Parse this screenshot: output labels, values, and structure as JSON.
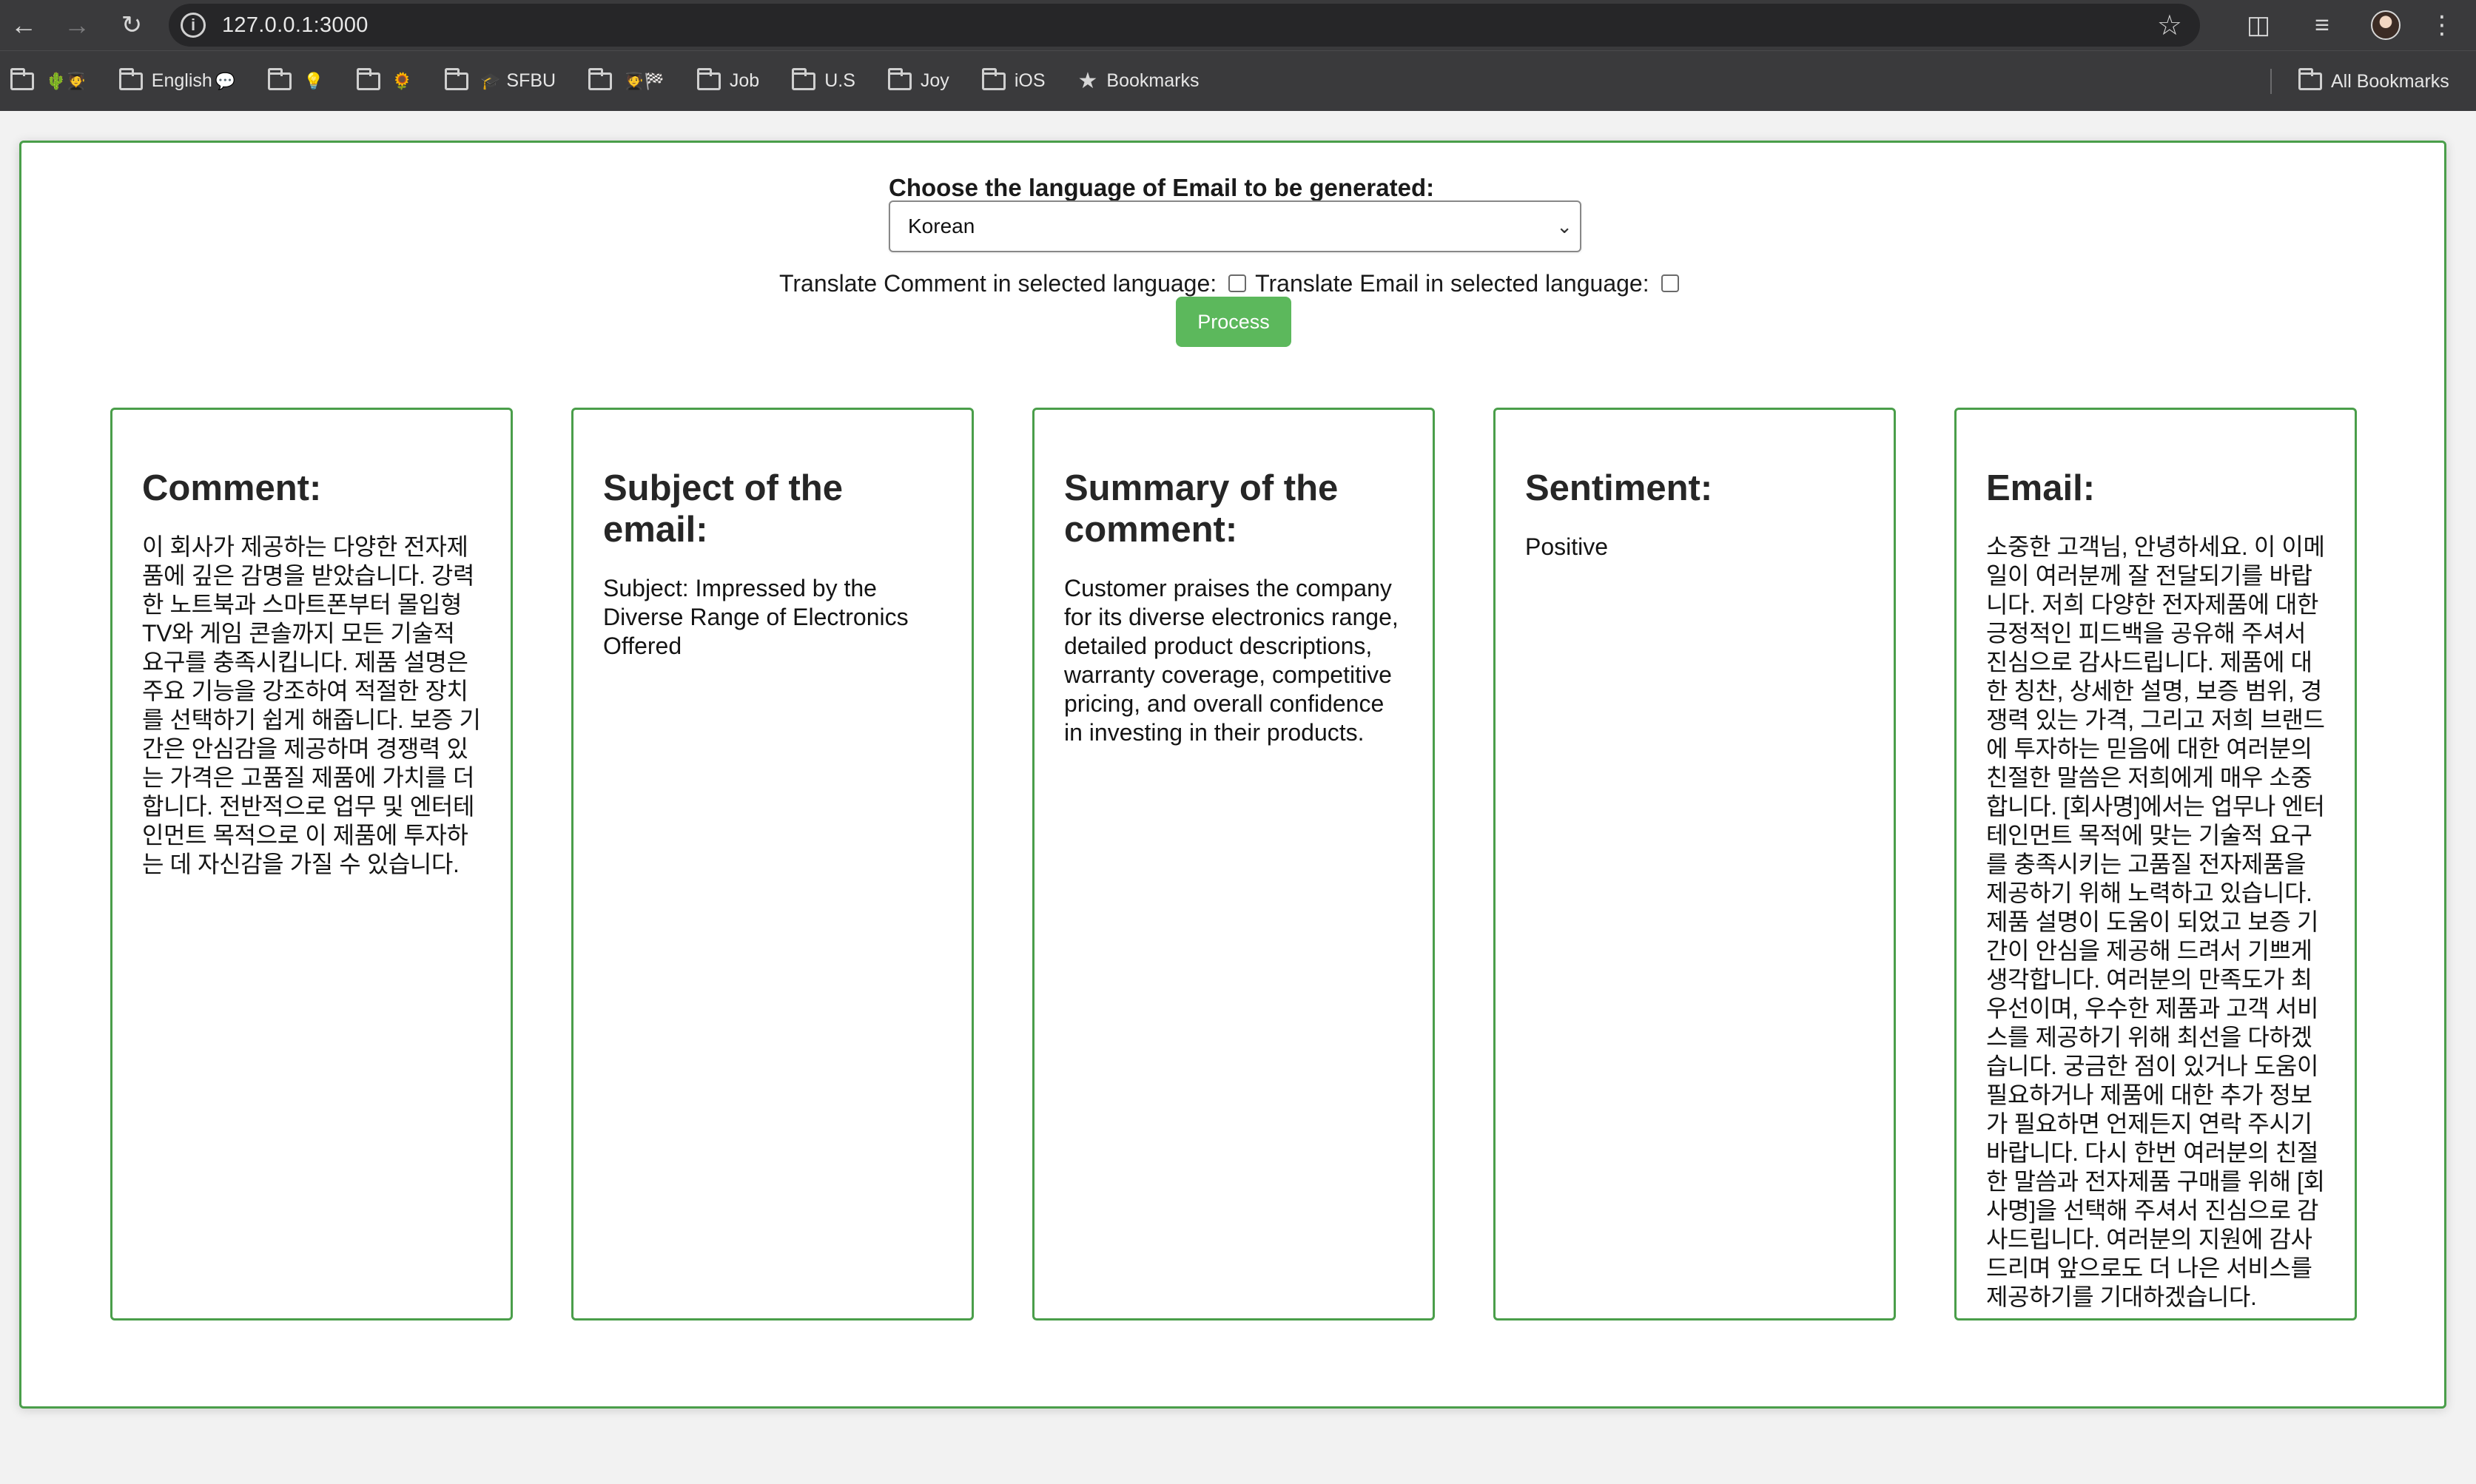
{
  "browser": {
    "url": "127.0.0.1:3000",
    "bookmarks": [
      {
        "label": "",
        "emoji": "🌵🧑‍🎓"
      },
      {
        "label": "English",
        "emoji": "💬"
      },
      {
        "label": "",
        "emoji": "💡"
      },
      {
        "label": "",
        "emoji": "🌻"
      },
      {
        "label": "SFBU",
        "emoji": "🎓"
      },
      {
        "label": "",
        "emoji": "🧑‍🎓🏁"
      },
      {
        "label": "Job",
        "emoji": ""
      },
      {
        "label": "U.S",
        "emoji": ""
      },
      {
        "label": "Joy",
        "emoji": ""
      },
      {
        "label": "iOS",
        "emoji": ""
      }
    ],
    "bookmarks_star_label": "Bookmarks",
    "all_bookmarks_label": "All Bookmarks"
  },
  "form": {
    "language_label": "Choose the language of Email to be generated:",
    "selected_language": "Korean",
    "translate_comment_label": "Translate Comment in selected language:",
    "translate_email_label": "Translate Email in selected language:",
    "process_label": "Process"
  },
  "cards": {
    "comment": {
      "title": "Comment:",
      "body": "이 회사가 제공하는 다양한 전자제품에 깊은 감명을 받았습니다. 강력한 노트북과 스마트폰부터 몰입형 TV와 게임 콘솔까지 모든 기술적 요구를 충족시킵니다. 제품 설명은 주요 기능을 강조하여 적절한 장치를 선택하기 쉽게 해줍니다. 보증 기간은 안심감을 제공하며 경쟁력 있는 가격은 고품질 제품에 가치를 더합니다. 전반적으로 업무 및 엔터테인먼트 목적으로 이 제품에 투자하는 데 자신감을 가질 수 있습니다."
    },
    "subject": {
      "title": "Subject of the email:",
      "body": "Subject: Impressed by the Diverse Range of Electronics Offered"
    },
    "summary": {
      "title": "Summary of the comment:",
      "body": "Customer praises the company for its diverse electronics range, detailed product descriptions, warranty coverage, competitive pricing, and overall confidence in investing in their products."
    },
    "sentiment": {
      "title": "Sentiment:",
      "body": "Positive"
    },
    "email": {
      "title": "Email:",
      "body": "소중한 고객님, 안녕하세요. 이 이메일이 여러분께 잘 전달되기를 바랍니다. 저희 다양한 전자제품에 대한 긍정적인 피드백을 공유해 주셔서 진심으로 감사드립니다. 제품에 대한 칭찬, 상세한 설명, 보증 범위, 경쟁력 있는 가격, 그리고 저희 브랜드에 투자하는 믿음에 대한 여러분의 친절한 말씀은 저희에게 매우 소중합니다. [회사명]에서는 업무나 엔터테인먼트 목적에 맞는 기술적 요구를 충족시키는 고품질 전자제품을 제공하기 위해 노력하고 있습니다. 제품 설명이 도움이 되었고 보증 기간이 안심을 제공해 드려서 기쁘게 생각합니다. 여러분의 만족도가 최우선이며, 우수한 제품과 고객 서비스를 제공하기 위해 최선을 다하겠습니다. 궁금한 점이 있거나 도움이 필요하거나 제품에 대한 추가 정보가 필요하면 언제든지 연락 주시기 바랍니다. 다시 한번 여러분의 친절한 말씀과 전자제품 구매를 위해 [회사명]을 선택해 주셔서 진심으로 감사드립니다. 여러분의 지원에 감사드리며 앞으로도 더 나은 서비스를 제공하기를 기대하겠습니다."
    }
  }
}
